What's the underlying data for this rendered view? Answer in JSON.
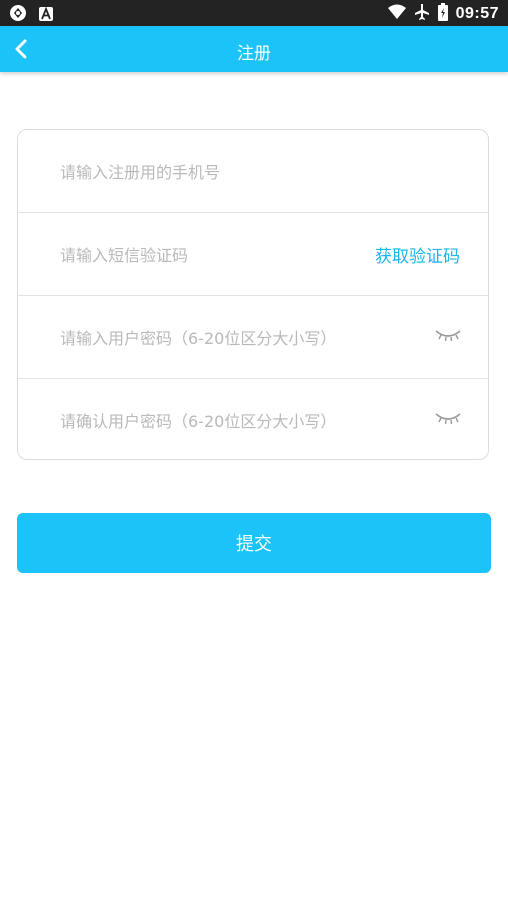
{
  "status_bar": {
    "time": "09:57",
    "icons": [
      "sync-icon",
      "notification-a-icon",
      "wifi-icon",
      "airplane-icon",
      "battery-icon"
    ]
  },
  "app_bar": {
    "title": "注册",
    "back_icon": "chevron-left-icon",
    "color": "#1bc3f8"
  },
  "form": {
    "phone_placeholder": "请输入注册用的手机号",
    "sms_code_placeholder": "请输入短信验证码",
    "get_code_label": "获取验证码",
    "password_placeholder": "请输入用户密码（6-20位区分大小写）",
    "confirm_password_placeholder": "请确认用户密码（6-20位区分大小写）",
    "eye_icon": "eye-closed-icon"
  },
  "submit_label": "提交"
}
